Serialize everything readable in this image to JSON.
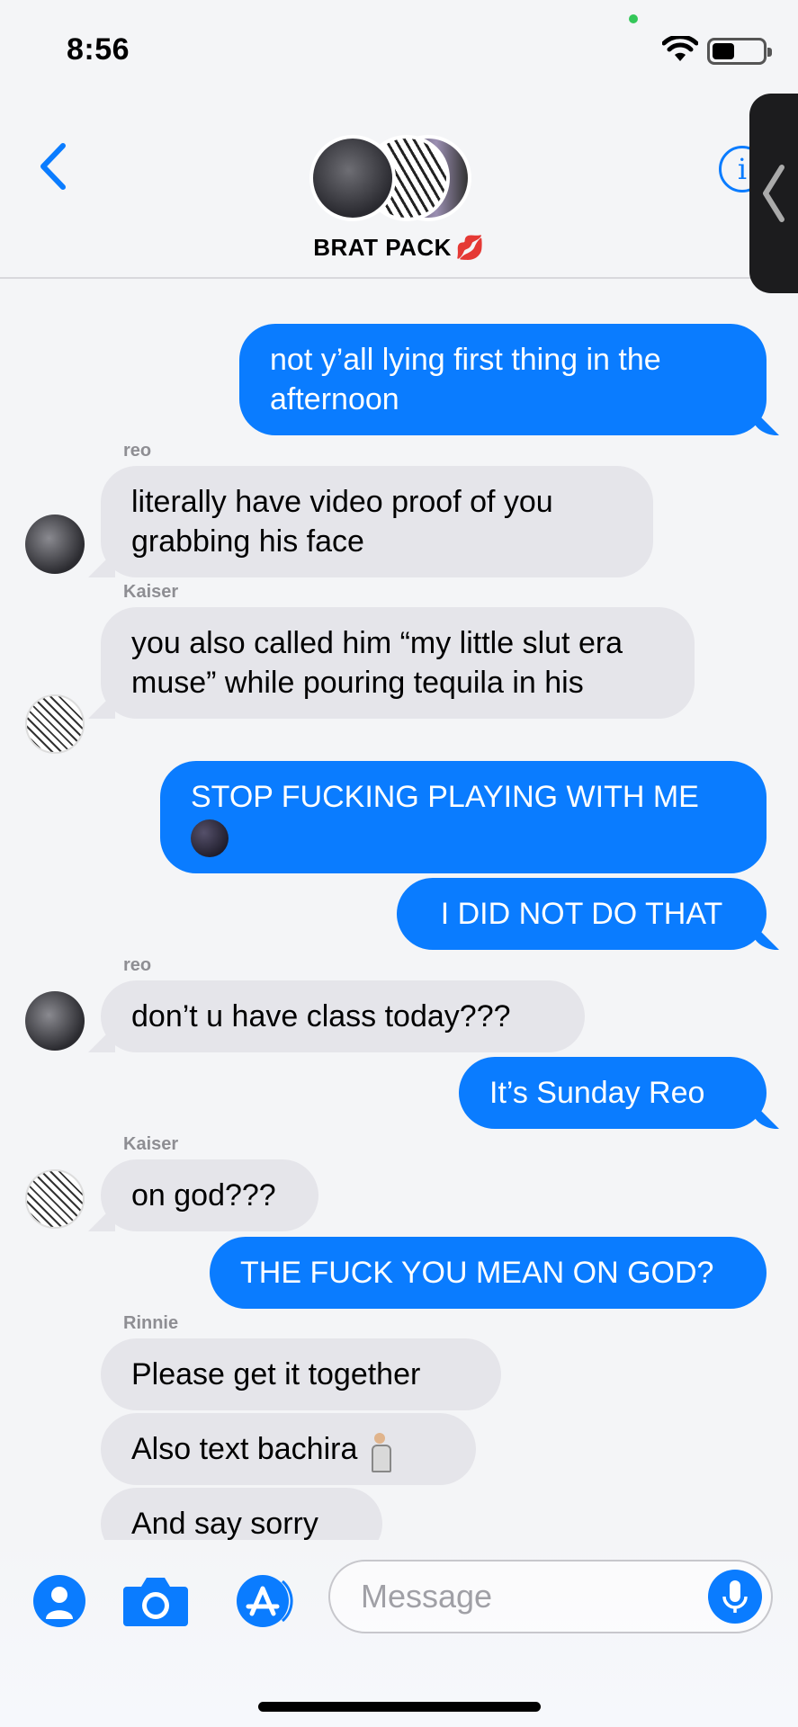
{
  "status_bar": {
    "time": "8:56",
    "battery_level": 0.45
  },
  "header": {
    "group_name": "BRAT PACK",
    "group_emoji": "💋",
    "info_label": "i"
  },
  "messages": [
    {
      "type": "sent",
      "text": "not y’all lying first thing in the afternoon"
    },
    {
      "type": "sender",
      "text": "reo"
    },
    {
      "type": "received",
      "text": "literally have video proof of you grabbing his face"
    },
    {
      "type": "sender",
      "text": "Kaiser"
    },
    {
      "type": "received",
      "text": "you also called him “my little slut era muse” while pouring tequila in his"
    },
    {
      "type": "sent",
      "text": "STOP FUCKING PLAYING WITH ME"
    },
    {
      "type": "sent",
      "text": "I DID NOT DO THAT"
    },
    {
      "type": "sender",
      "text": "reo"
    },
    {
      "type": "received",
      "text": "don’t u have class today???"
    },
    {
      "type": "sent",
      "text": "It’s Sunday Reo"
    },
    {
      "type": "sender",
      "text": "Kaiser"
    },
    {
      "type": "received",
      "text": "on god???"
    },
    {
      "type": "sent",
      "text": "THE FUCK YOU MEAN ON GOD?"
    },
    {
      "type": "sender",
      "text": "Rinnie"
    },
    {
      "type": "received",
      "text": "Please get it together"
    },
    {
      "type": "received",
      "text": "Also text bachira"
    },
    {
      "type": "received",
      "text": "And say sorry"
    }
  ],
  "composer": {
    "placeholder": "Message"
  },
  "colors": {
    "sent_bubble": "#0a7cff",
    "received_bubble": "#e5e5ea",
    "accent": "#0a7cff"
  }
}
